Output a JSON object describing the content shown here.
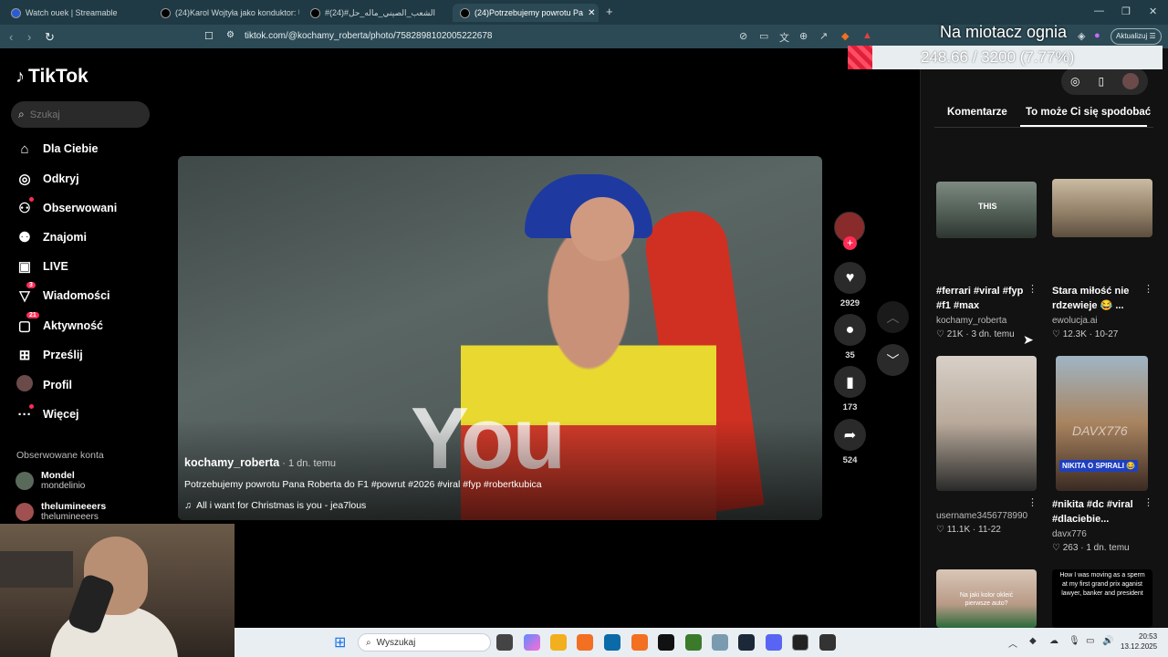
{
  "browser": {
    "tabs": [
      {
        "title": "Watch ouek | Streamable"
      },
      {
        "title": "(24)Karol Wojtyła jako konduktor: Ur"
      },
      {
        "title": "#الشعب_الصيني_ماله_حل#(24)"
      },
      {
        "title": "(24)Potrzebujemy powrotu Pa"
      }
    ],
    "url": "tiktok.com/@kochamy_roberta/photo/7582898102005222678",
    "update_label": "Aktualizuj"
  },
  "overlay": {
    "title": "Na miotacz ognia",
    "progress_text": "248.66 / 3200 (7.77%)",
    "progress_value": 248.66,
    "progress_max": 3200
  },
  "sidebar": {
    "logo": "TikTok",
    "search_placeholder": "Szukaj",
    "items": [
      {
        "label": "Dla Ciebie",
        "icon": "home-icon"
      },
      {
        "label": "Odkryj",
        "icon": "compass-icon"
      },
      {
        "label": "Obserwowani",
        "icon": "user-follow-icon"
      },
      {
        "label": "Znajomi",
        "icon": "friends-icon"
      },
      {
        "label": "LIVE",
        "icon": "live-icon"
      },
      {
        "label": "Wiadomości",
        "icon": "messages-icon",
        "badge": "3"
      },
      {
        "label": "Aktywność",
        "icon": "activity-icon",
        "badge": "21"
      },
      {
        "label": "Prześlij",
        "icon": "upload-icon"
      },
      {
        "label": "Profil",
        "icon": "profile-avatar-icon"
      },
      {
        "label": "Więcej",
        "icon": "more-icon"
      }
    ],
    "following_title": "Obserwowane konta",
    "following": [
      {
        "name": "Mondel",
        "handle": "mondelinio"
      },
      {
        "name": "thelumineeers",
        "handle": "thelumineeers"
      }
    ]
  },
  "video": {
    "overlay_word": "You",
    "author": "kochamy_roberta",
    "time": " · 1 dn. temu",
    "description": "Potrzebujemy powrotu Pana Roberta do F1 #powrut #2026 #viral #fyp #robertkubica",
    "music": "All i want for Christmas is you - jea7lous",
    "likes": "2929",
    "comments": "35",
    "saves": "173",
    "shares": "524"
  },
  "panel": {
    "tab_comments": "Komentarze",
    "tab_suggested": "To może Ci się spodobać",
    "cards": [
      {
        "title": "#ferrari #viral #fyp #f1 #max",
        "author": "kochamy_roberta",
        "likes": "21K",
        "date": "3 dn. temu",
        "thumb_text": "THIS"
      },
      {
        "title": "Stara miłość nie rdzewieje 😂 ...",
        "author": "ewolucja.ai",
        "likes": "12.3K",
        "date": "10-27"
      },
      {
        "title": "",
        "author": "username3456778990",
        "likes": "11.1K",
        "date": "11-22"
      },
      {
        "title": "#nikita #dc #viral #dlaciebie...",
        "author": "davx776",
        "likes": "263",
        "date": "1 dn. temu",
        "thumb_text": "NIKITA O SPIRALI 😂",
        "watermark": "DAVX776"
      },
      {
        "title": "",
        "author": "",
        "likes": "",
        "date": "",
        "thumb_text": "Na jaki kolor okleić pierwsze auto?"
      },
      {
        "title": "",
        "author": "",
        "likes": "",
        "date": "",
        "thumb_text": "How I was moving as a sperm at my first grand prix aganist lawyer, banker and president"
      }
    ]
  },
  "taskbar": {
    "search_placeholder": "Wyszukaj",
    "time": "20:53",
    "date": "13.12.2025"
  }
}
